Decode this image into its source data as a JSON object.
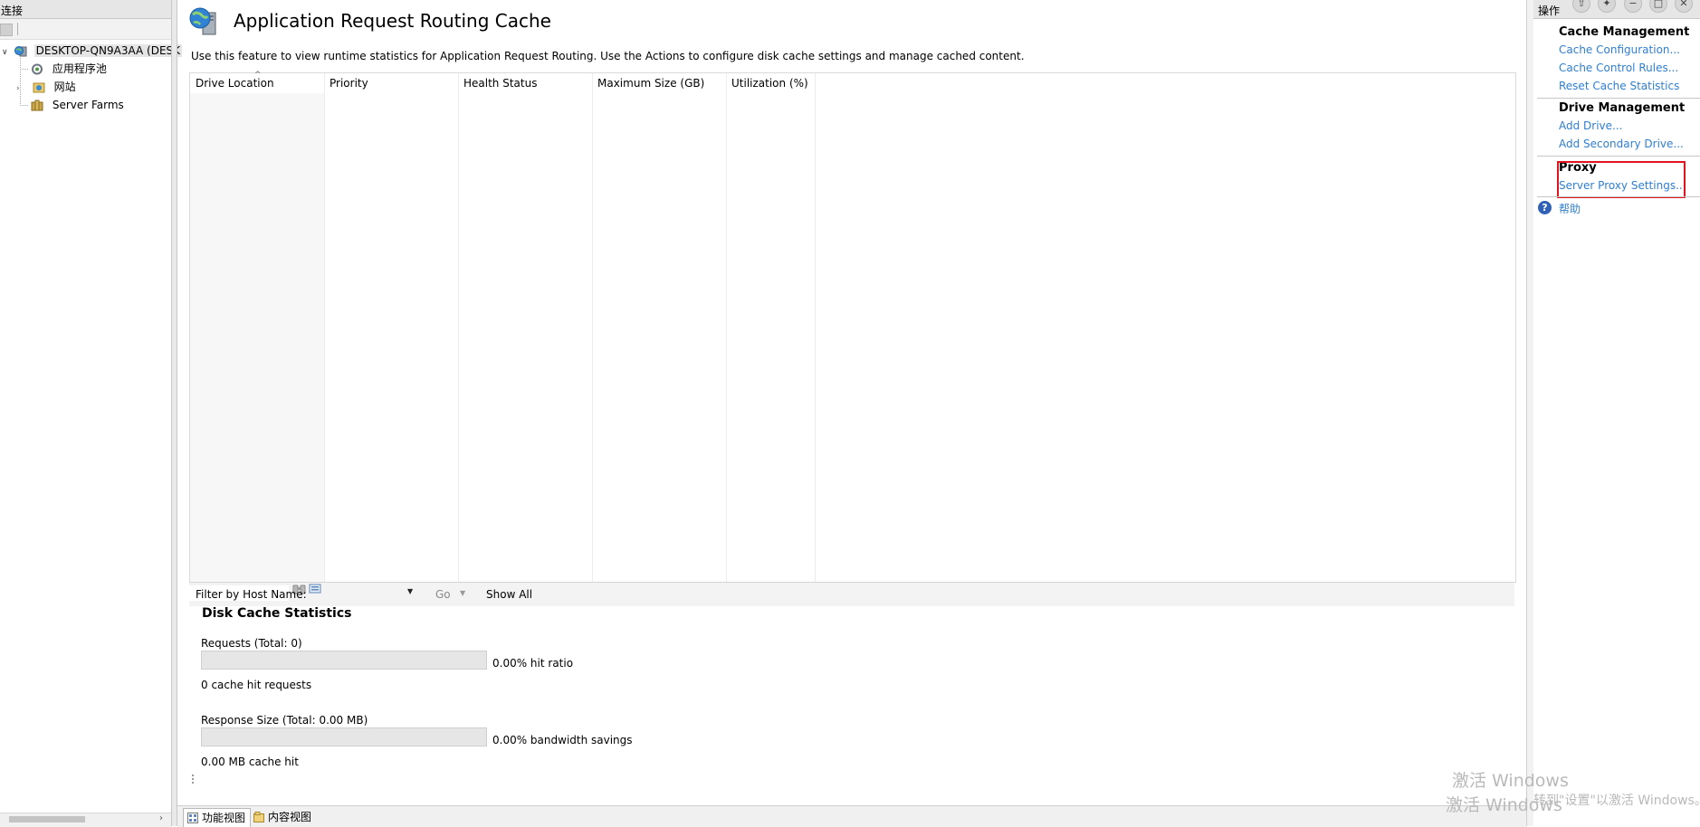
{
  "connections": {
    "title": "连接",
    "tree": [
      {
        "label": "DESKTOP-QN9A3AA (DESK",
        "icon": "server-icon",
        "expanded": true,
        "selected": true
      },
      {
        "label": "应用程序池",
        "icon": "app-pool-icon"
      },
      {
        "label": "网站",
        "icon": "sites-icon",
        "collapsed": true
      },
      {
        "label": "Server Farms",
        "icon": "server-farms-icon"
      }
    ]
  },
  "main": {
    "title": "Application Request Routing Cache",
    "description": "Use this feature to view runtime statistics for Application Request Routing.  Use the Actions to configure disk cache settings and manage cached content.",
    "columns": [
      "Drive Location",
      "Priority",
      "Health Status",
      "Maximum Size (GB)",
      "Utilization (%)"
    ],
    "filter": {
      "label": "Filter by Host Name:",
      "value": "",
      "go_label": "Go",
      "show_all_label": "Show All"
    },
    "stats": {
      "title": "Disk Cache Statistics",
      "requests_label": "Requests (Total: 0)",
      "requests_progress": 0,
      "hit_ratio": "0.00% hit ratio",
      "hit_requests": "0 cache hit requests",
      "response_label": "Response Size (Total: 0.00 MB)",
      "response_progress": 0,
      "bandwidth": "0.00% bandwidth savings",
      "mb_hit": "0.00 MB cache hit"
    },
    "bottom_tabs": [
      "功能视图",
      "内容视图"
    ]
  },
  "actions": {
    "title": "操作",
    "sections": [
      {
        "title": "Cache Management",
        "links": [
          "Cache Configuration...",
          "Cache Control Rules...",
          "Reset Cache Statistics"
        ]
      },
      {
        "title": "Drive Management",
        "links": [
          "Add Drive...",
          "Add Secondary Drive..."
        ]
      },
      {
        "title": "Proxy",
        "links": [
          "Server Proxy Settings..."
        ]
      }
    ],
    "help_label": "帮助"
  },
  "watermark": {
    "line1": "激活 Windows",
    "line2": "激活 Windows",
    "line3": "转到\"设置\"以激活 Windows。"
  },
  "colors": {
    "link": "#2f7fd1",
    "highlight": "#e0141e"
  }
}
